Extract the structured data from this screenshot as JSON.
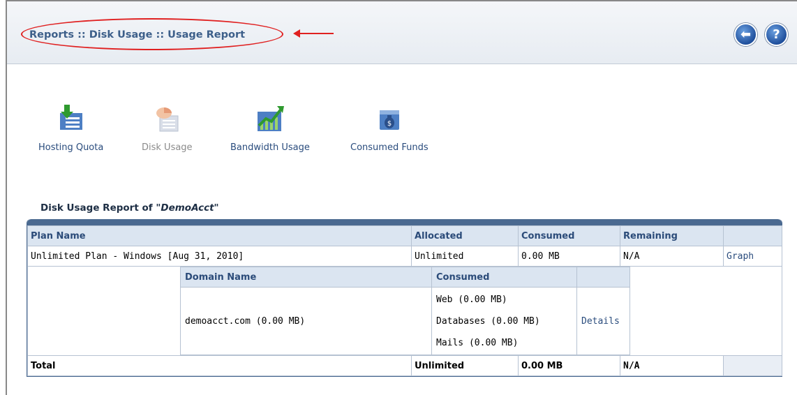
{
  "header": {
    "breadcrumb": "Reports :: Disk Usage :: Usage Report",
    "back_icon": "arrow-left-circle-icon",
    "help_icon": "question-circle-icon"
  },
  "toolbar": {
    "items": [
      {
        "label": "Hosting Quota",
        "icon": "hosting-quota-icon"
      },
      {
        "label": "Disk Usage",
        "icon": "disk-usage-icon"
      },
      {
        "label": "Bandwidth Usage",
        "icon": "bandwidth-usage-icon"
      },
      {
        "label": "Consumed Funds",
        "icon": "consumed-funds-icon"
      }
    ]
  },
  "report": {
    "title_prefix": "Disk Usage Report of ",
    "account": "\"DemoAcct\"",
    "columns": [
      "Plan Name",
      "Allocated",
      "Consumed",
      "Remaining",
      ""
    ],
    "plan": {
      "name": "Unlimited Plan - Windows [Aug 31, 2010]",
      "allocated": "Unlimited",
      "consumed": "0.00 MB",
      "remaining": "N/A",
      "action": "Graph"
    },
    "domains": {
      "columns": [
        "Domain Name",
        "Consumed",
        ""
      ],
      "rows": [
        {
          "name": "demoacct.com (0.00 MB)",
          "web": "Web (0.00 MB)",
          "databases": "Databases (0.00 MB)",
          "mails": "Mails (0.00 MB)",
          "action": "Details"
        }
      ]
    },
    "total": {
      "label": "Total",
      "allocated": "Unlimited",
      "consumed": "0.00 MB",
      "remaining": "N/A"
    }
  },
  "colors": {
    "header_text": "#3d5f8a",
    "grid_border": "#4a6990",
    "header_cell_bg": "#dbe5f1",
    "annotation_red": "#e02020"
  }
}
